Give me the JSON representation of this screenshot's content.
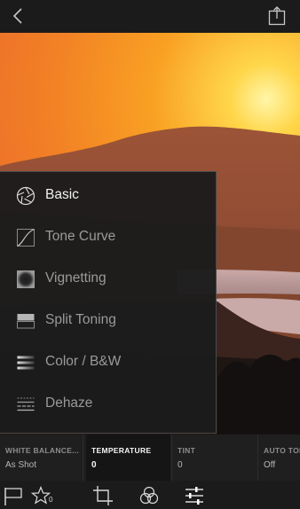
{
  "menu": {
    "items": [
      {
        "label": "Basic",
        "icon": "aperture-icon",
        "active": true
      },
      {
        "label": "Tone Curve",
        "icon": "tone-curve-icon",
        "active": false
      },
      {
        "label": "Vignetting",
        "icon": "vignette-icon",
        "active": false
      },
      {
        "label": "Split Toning",
        "icon": "split-toning-icon",
        "active": false
      },
      {
        "label": "Color / B&W",
        "icon": "color-bw-icon",
        "active": false
      },
      {
        "label": "Dehaze",
        "icon": "dehaze-icon",
        "active": false
      }
    ]
  },
  "params": [
    {
      "label": "WHITE BALANCE...",
      "value": "As Shot",
      "active": false
    },
    {
      "label": "TEMPERATURE",
      "value": "0",
      "active": true
    },
    {
      "label": "TINT",
      "value": "0",
      "active": false
    },
    {
      "label": "AUTO TONE",
      "value": "Off",
      "active": false
    }
  ],
  "toolbar": {
    "rating": "0",
    "icons": [
      "flag-icon",
      "star-icon",
      "crop-icon",
      "presets-icon",
      "adjust-sliders-icon"
    ]
  },
  "colors": {
    "background": "#1b1b1b",
    "menu_bg": "#1c1c1c",
    "active_text": "#f2f2f2",
    "inactive_text": "#9a9a9a"
  }
}
